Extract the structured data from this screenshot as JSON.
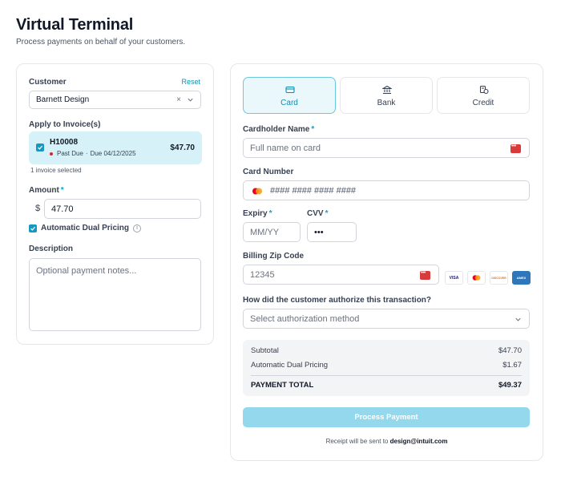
{
  "header": {
    "title": "Virtual Terminal",
    "subtitle": "Process payments on behalf of your customers."
  },
  "left": {
    "customer_label": "Customer",
    "reset_label": "Reset",
    "customer_value": "Barnett Design",
    "clear_glyph": "×",
    "apply_label": "Apply to Invoice(s)",
    "invoice": {
      "number": "H10008",
      "status": "Past Due",
      "separator": "·",
      "due": "Due 04/12/2025",
      "amount": "$47.70",
      "checked": true
    },
    "invoice_count": "1 invoice selected",
    "amount_label": "Amount",
    "currency_symbol": "$",
    "amount_value": "47.70",
    "adp_label": "Automatic Dual Pricing",
    "adp_checked": true,
    "info_glyph": "i",
    "description_label": "Description",
    "description_placeholder": "Optional payment notes..."
  },
  "right": {
    "tabs": [
      {
        "label": "Card",
        "icon": "card-icon",
        "active": true
      },
      {
        "label": "Bank",
        "icon": "bank-icon",
        "active": false
      },
      {
        "label": "Credit",
        "icon": "credit-icon",
        "active": false
      }
    ],
    "cardholder_label": "Cardholder Name",
    "cardholder_placeholder": "Full name on card",
    "card_number_label": "Card Number",
    "card_number_placeholder": "#### #### #### ####",
    "expiry_label": "Expiry",
    "expiry_placeholder": "MM/YY",
    "cvv_label": "CVV",
    "cvv_placeholder": "•••",
    "zip_label": "Billing Zip Code",
    "zip_placeholder": "12345",
    "card_brands": [
      "VISA",
      "mastercard",
      "DISCOVER",
      "AMEX"
    ],
    "auth_question": "How did the customer authorize this transaction?",
    "auth_placeholder": "Select authorization method",
    "summary": {
      "subtotal_label": "Subtotal",
      "subtotal_value": "$47.70",
      "adp_label": "Automatic Dual Pricing",
      "adp_value": "$1.67",
      "total_label": "PAYMENT TOTAL",
      "total_value": "$49.37"
    },
    "pay_button": "Process Payment",
    "receipt_prefix": "Receipt will be sent to",
    "receipt_email": "design@intuit.com"
  },
  "colors": {
    "accent": "#0e8fb0",
    "checkbox": "#1599c1",
    "invoice_bg": "#d7f1f8",
    "pay_button_disabled": "#93d8ec",
    "past_due": "#dc2626"
  }
}
